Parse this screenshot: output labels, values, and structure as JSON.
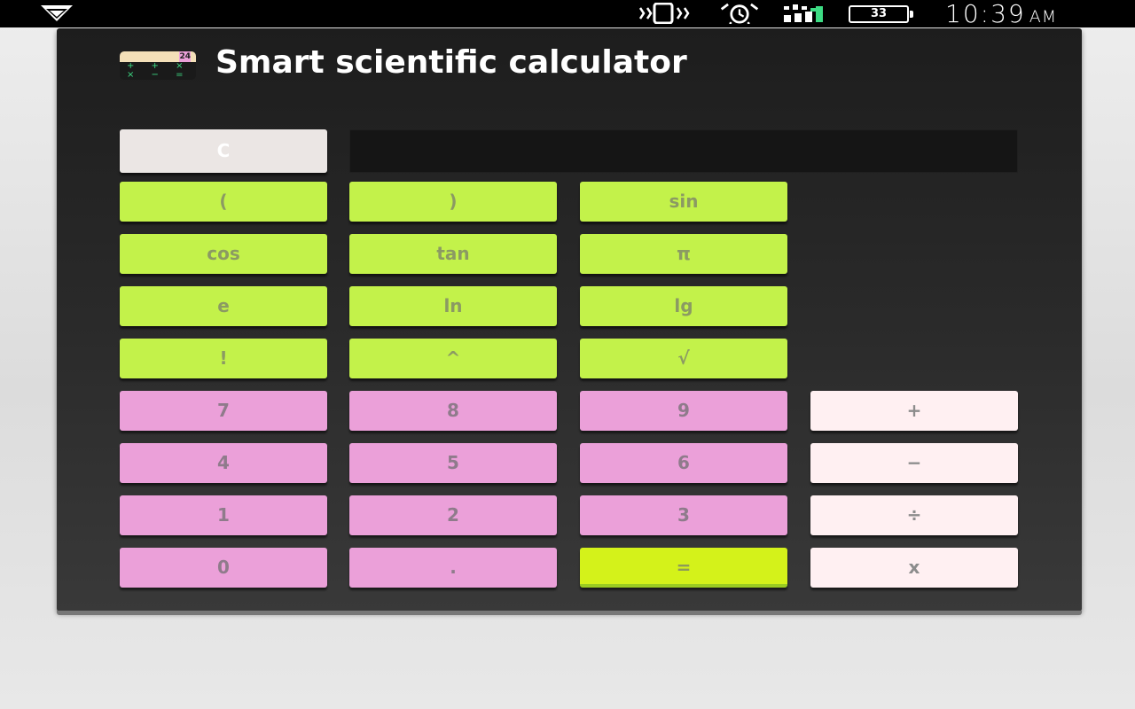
{
  "status_bar": {
    "time": "10:39",
    "ampm": "AM",
    "battery_level": "33",
    "icons": [
      "notification-chevron-icon",
      "vibrate-icon",
      "alarm-icon",
      "signal-icon",
      "battery-icon"
    ]
  },
  "app": {
    "title": "Smart scientific calculator",
    "icon_number": "24",
    "display_value": ""
  },
  "buttons": {
    "clear": "C",
    "lparen": "(",
    "rparen": ")",
    "sin": "sin",
    "cos": "cos",
    "tan": "tan",
    "pi": "π",
    "e": "e",
    "ln": "ln",
    "lg": "lg",
    "factorial": "!",
    "power": "^",
    "sqrt": "√",
    "d7": "7",
    "d8": "8",
    "d9": "9",
    "plus": "+",
    "d4": "4",
    "d5": "5",
    "d6": "6",
    "minus": "−",
    "d1": "1",
    "d2": "2",
    "d3": "3",
    "divide": "÷",
    "d0": "0",
    "dot": ".",
    "equals": "=",
    "multiply": "x"
  },
  "colors": {
    "function_key": "#c3f24a",
    "number_key": "#eba0d9",
    "operator_key": "#fff0f2",
    "equals_key": "#d4f21a",
    "clear_key": "#ebe6e4"
  }
}
